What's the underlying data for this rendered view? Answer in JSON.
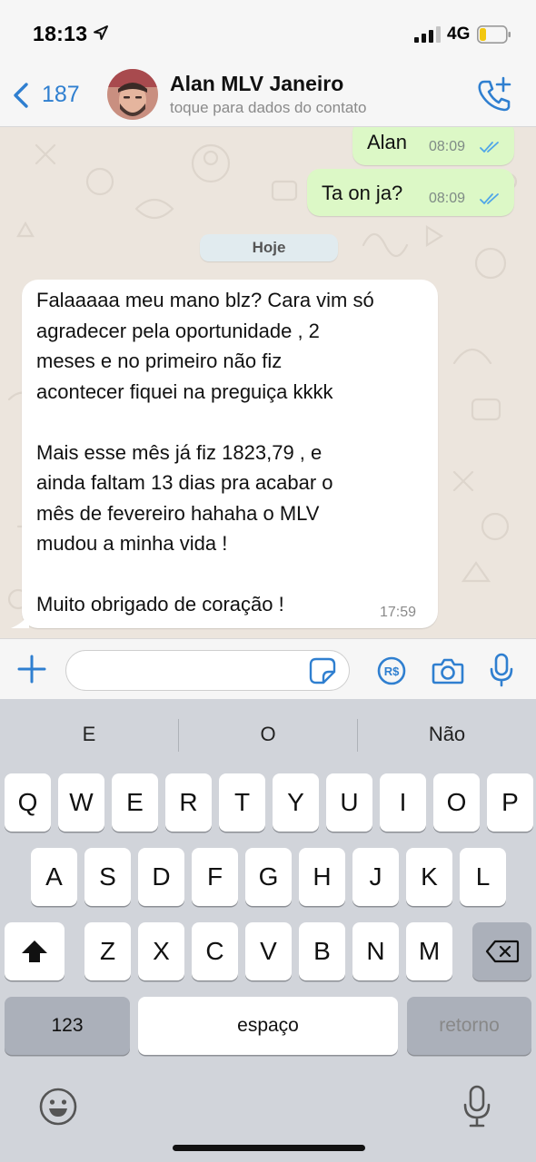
{
  "status_bar": {
    "time": "18:13",
    "network": "4G"
  },
  "header": {
    "back_count": "187",
    "contact_name": "Alan MLV Janeiro",
    "contact_subtitle": "toque para dados do contato"
  },
  "chat": {
    "messages_out": [
      {
        "text": "Alan",
        "time": "08:09"
      },
      {
        "text": "Ta on ja?",
        "time": "08:09"
      }
    ],
    "day_divider": "Hoje",
    "message_in": {
      "lines": [
        "Falaaaaa meu mano blz? Cara vim só",
        "agradecer pela oportunidade , 2",
        "meses e no primeiro não fiz",
        "acontecer fiquei na preguiça kkkk",
        "",
        "Mais esse mês já fiz 1823,79 , e",
        "ainda faltam 13 dias pra acabar o",
        "mês de fevereiro hahaha o MLV",
        "mudou a minha vida !",
        "",
        "Muito obrigado de coração !"
      ],
      "time": "17:59"
    }
  },
  "keyboard": {
    "suggestions": [
      "E",
      "O",
      "Não"
    ],
    "row1": [
      "Q",
      "W",
      "E",
      "R",
      "T",
      "Y",
      "U",
      "I",
      "O",
      "P"
    ],
    "row2": [
      "A",
      "S",
      "D",
      "F",
      "G",
      "H",
      "J",
      "K",
      "L"
    ],
    "row3": [
      "Z",
      "X",
      "C",
      "V",
      "B",
      "N",
      "M"
    ],
    "numbers_key": "123",
    "space_key": "espaço",
    "return_key": "retorno"
  },
  "icons": {
    "back": "chevron-left-icon",
    "call": "phone-add-icon",
    "attach": "plus-icon",
    "sticker": "sticker-icon",
    "payment": "pix-real-icon",
    "camera": "camera-icon",
    "mic": "microphone-icon",
    "read_receipt": "double-check-icon",
    "shift": "shift-arrow-icon",
    "delete": "backspace-icon",
    "emoji": "emoji-icon",
    "dictation": "dictation-mic-icon"
  },
  "colors": {
    "accent_blue": "#2f7fd0",
    "outgoing_bubble": "#dcf8c6",
    "incoming_bubble": "#ffffff",
    "chat_background": "#ece5dd",
    "read_tick": "#4fa5e8"
  }
}
